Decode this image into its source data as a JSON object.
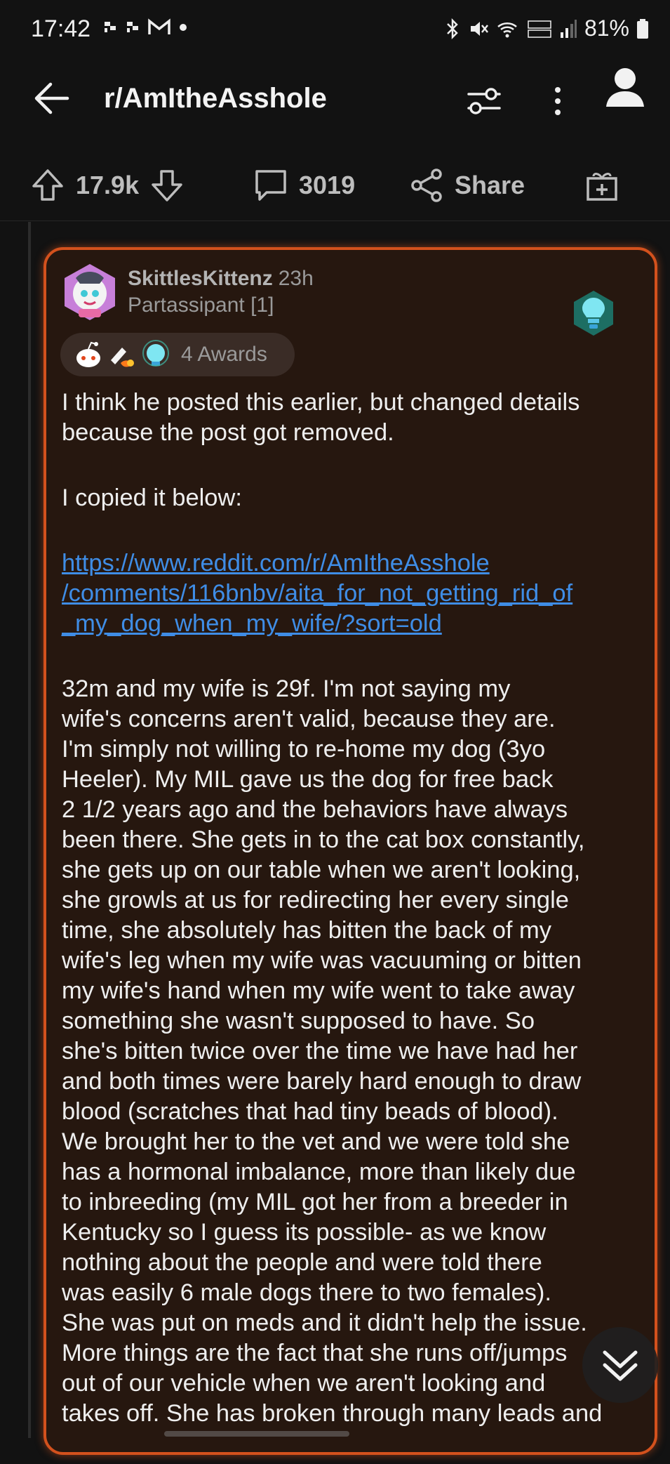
{
  "status_bar": {
    "time": "17:42",
    "battery": "81%",
    "icons": [
      "chat-icon",
      "chat-icon",
      "gmail-icon",
      "dot-icon",
      "bluetooth-icon",
      "mute-icon",
      "wifi-6-icon",
      "volte-icon",
      "signal-icon",
      "battery-icon"
    ]
  },
  "header": {
    "subreddit": "r/AmItheAsshole",
    "icons": [
      "back-arrow-icon",
      "filter-icon",
      "more-vertical-icon",
      "profile-icon"
    ]
  },
  "actions": {
    "upvotes": "17.9k",
    "comments": "3019",
    "share_label": "Share",
    "icons": [
      "upvote-icon",
      "downvote-icon",
      "comment-icon",
      "share-icon",
      "gift-icon"
    ]
  },
  "comment": {
    "author": "SkittlesKittenz",
    "age": "23h",
    "flair": "Partassipant [1]",
    "awards_label": "4 Awards",
    "award_icons": [
      "snoo-award-icon",
      "rocket-like-award-icon",
      "lightbulb-award-icon"
    ],
    "badge_icon": "lightbulb-badge-icon",
    "paragraphs": [
      [
        "I think he posted this earlier, but changed details",
        "because the post got removed."
      ],
      [
        "I copied it below:"
      ]
    ],
    "link_lines": [
      "https://www.reddit.com/r/AmItheAsshole",
      "/comments/116bnbv/aita_for_not_getting_rid_of",
      "_my_dog_when_my_wife/?sort=old"
    ],
    "story_lines": [
      "32m and my wife is 29f. I'm not saying my",
      "wife's concerns aren't valid, because they are.",
      "I'm simply not willing to re-home my dog (3yo",
      "Heeler). My MIL gave us the dog for free back",
      "2 1/2 years ago and the behaviors have always",
      "been there. She gets in to the cat box constantly,",
      "she gets up on our table when we aren't looking,",
      "she growls at us for redirecting her every single",
      "time, she absolutely has bitten the back of my",
      "wife's leg when my wife was vacuuming or bitten",
      "my wife's hand when my wife went to take away",
      "something she wasn't supposed to have. So",
      "she's bitten twice over the time we have had her",
      "and both times were barely hard enough to draw",
      "blood (scratches that had tiny beads of blood).",
      "We brought her to the vet and we were told she",
      "has a hormonal imbalance, more than likely due",
      "to inbreeding (my MIL got her from a breeder in",
      "Kentucky so I guess its possible- as we know",
      "nothing about the people and were told there",
      "was easily 6 male dogs there to two females).",
      "She was put on meds and it didn't help the issue.",
      "More things are the fact that she runs off/jumps",
      "out of our vehicle when we aren't looking and",
      "takes off. She has broken through many leads and"
    ]
  },
  "floating": {
    "scroll_icon": "chevron-double-down-icon"
  }
}
